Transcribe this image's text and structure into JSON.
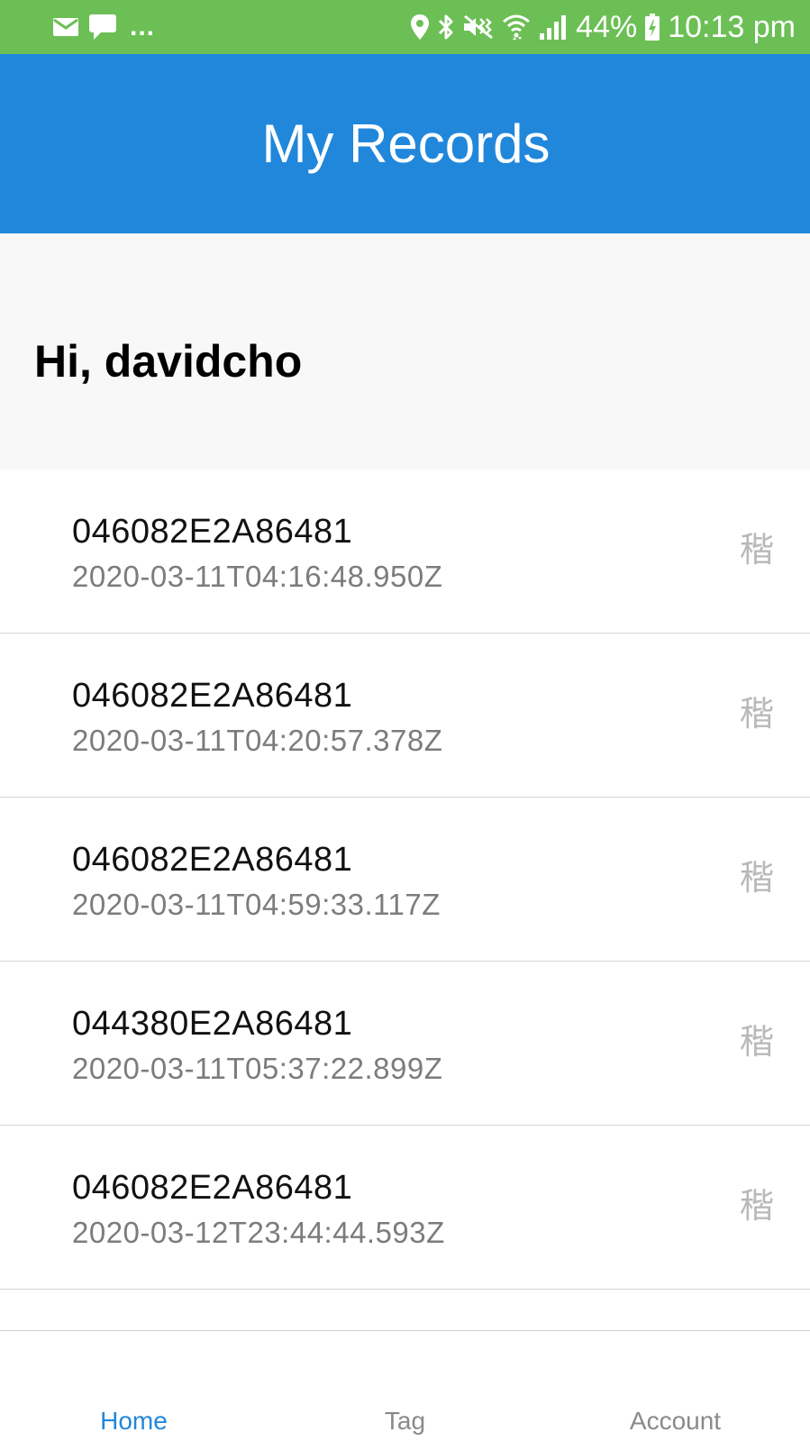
{
  "status_bar": {
    "battery": "44%",
    "time": "10:13 pm",
    "overflow": "...",
    "left_icons": [
      "mail-icon",
      "chat-icon"
    ],
    "right_icons": [
      "location-icon",
      "bluetooth-icon",
      "vibrate-mute-icon",
      "wifi-icon",
      "signal-icon",
      "battery-charging-icon"
    ]
  },
  "header": {
    "title": "My Records",
    "color": "#2187db"
  },
  "greeting": "Hi, davidcho",
  "records": [
    {
      "id": "046082E2A86481",
      "timestamp": "2020-03-11T04:16:48.950Z",
      "action": "稭"
    },
    {
      "id": "046082E2A86481",
      "timestamp": "2020-03-11T04:20:57.378Z",
      "action": "稭"
    },
    {
      "id": "046082E2A86481",
      "timestamp": "2020-03-11T04:59:33.117Z",
      "action": "稭"
    },
    {
      "id": "044380E2A86481",
      "timestamp": "2020-03-11T05:37:22.899Z",
      "action": "稭"
    },
    {
      "id": "046082E2A86481",
      "timestamp": "2020-03-12T23:44:44.593Z",
      "action": "稭"
    }
  ],
  "tabs": [
    {
      "label": "Home",
      "active": true
    },
    {
      "label": "Tag",
      "active": false
    },
    {
      "label": "Account",
      "active": false
    }
  ],
  "colors": {
    "status_bar": "#6cbf55",
    "accent": "#2187db",
    "inactive_tab": "#8a8a8a"
  }
}
